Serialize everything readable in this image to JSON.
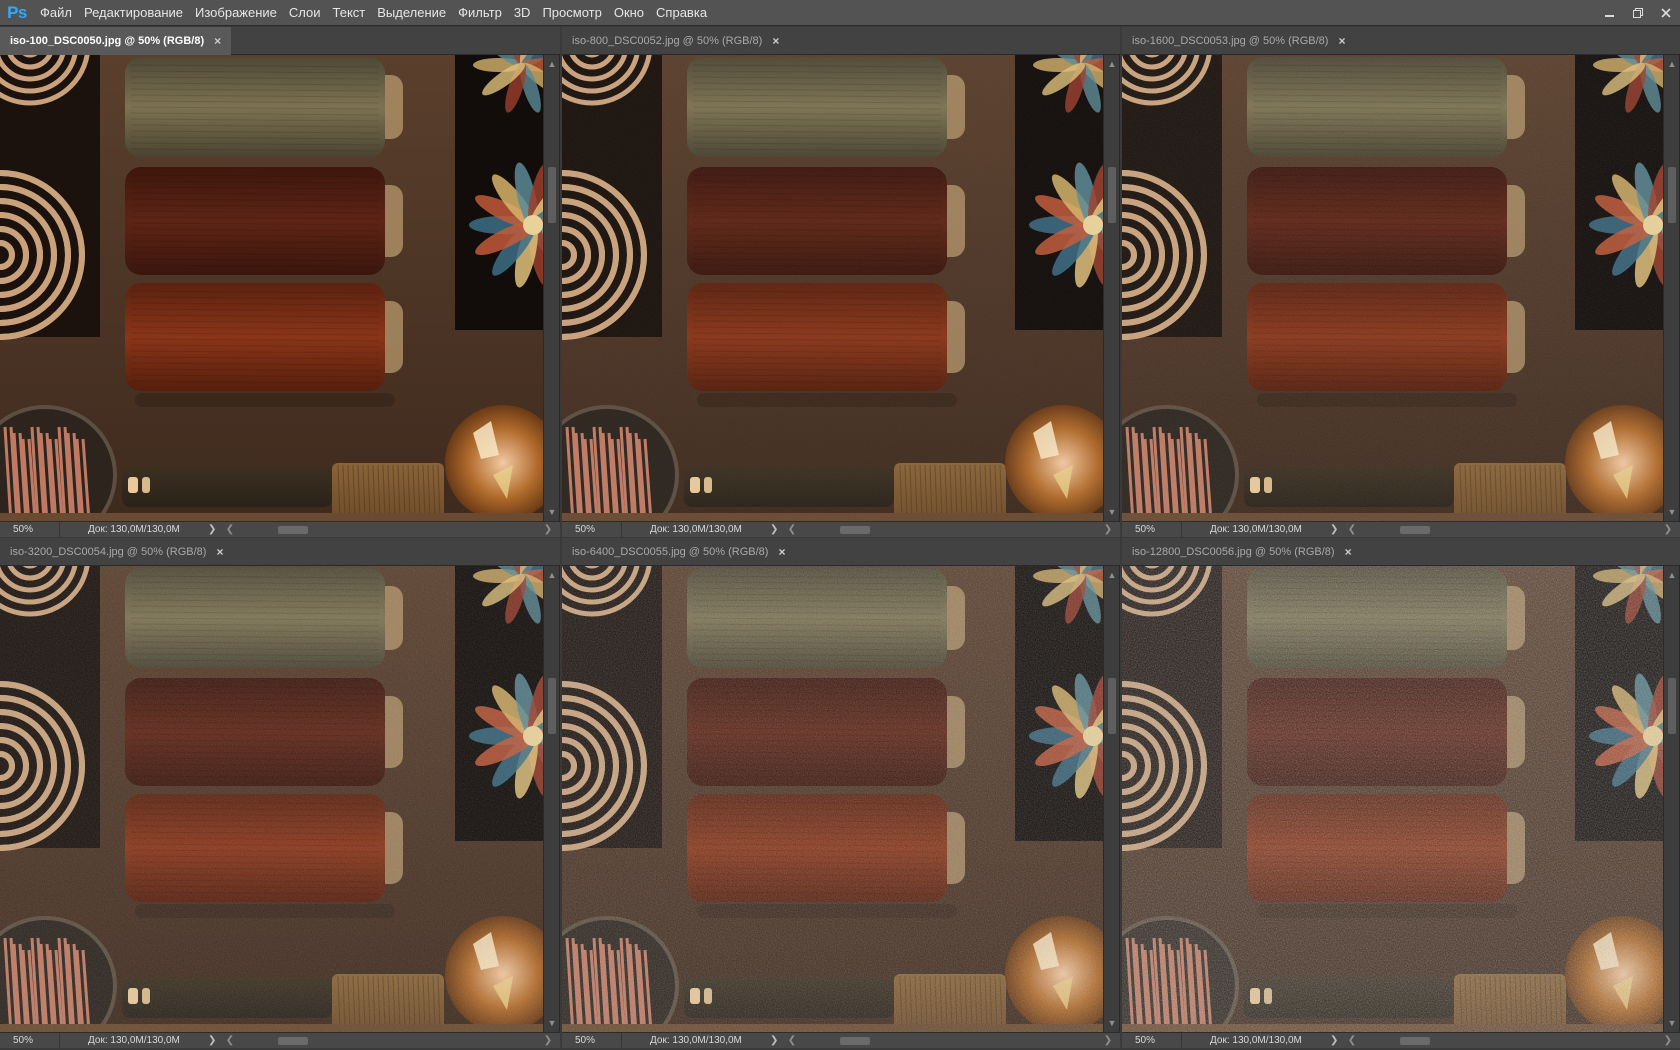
{
  "app": {
    "logo": "Ps",
    "menu": [
      "Файл",
      "Редактирование",
      "Изображение",
      "Слои",
      "Текст",
      "Выделение",
      "Фильтр",
      "3D",
      "Просмотр",
      "Окно",
      "Справка"
    ],
    "window_controls": [
      "minimize-icon",
      "restore-icon",
      "close-icon"
    ]
  },
  "documents": [
    {
      "tab": "iso-100_DSC0050.jpg @ 50% (RGB/8)",
      "active": true,
      "zoom": "50%",
      "doc_info": "Док: 130,0M/130,0M",
      "noise": 0
    },
    {
      "tab": "iso-800_DSC0052.jpg @ 50% (RGB/8)",
      "active": false,
      "zoom": "50%",
      "doc_info": "Док: 130,0M/130,0M",
      "noise": 0.08
    },
    {
      "tab": "iso-1600_DSC0053.jpg @ 50% (RGB/8)",
      "active": false,
      "zoom": "50%",
      "doc_info": "Док: 130,0M/130,0M",
      "noise": 0.14
    },
    {
      "tab": "iso-3200_DSC0054.jpg @ 50% (RGB/8)",
      "active": false,
      "zoom": "50%",
      "doc_info": "Док: 130,0M/130,0M",
      "noise": 0.22
    },
    {
      "tab": "iso-6400_DSC0055.jpg @ 50% (RGB/8)",
      "active": false,
      "zoom": "50%",
      "doc_info": "Док: 130,0M/130,0M",
      "noise": 0.34
    },
    {
      "tab": "iso-12800_DSC0056.jpg @ 50% (RGB/8)",
      "active": false,
      "zoom": "50%",
      "doc_info": "Док: 130,0M/130,0M",
      "noise": 0.5
    }
  ],
  "tab_close_glyph": "×",
  "colors": {
    "menubar": "#535353",
    "active_tab": "#595959",
    "photo_background": "#4a3324",
    "spool_top": "#7d7352",
    "spool_middle": "#5e2415",
    "spool_bottom": "#8a3518"
  }
}
